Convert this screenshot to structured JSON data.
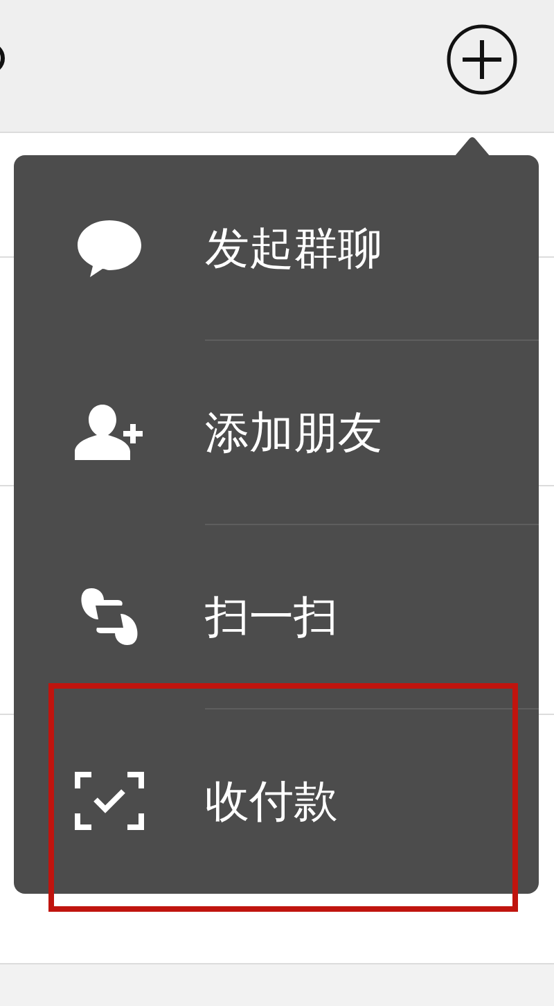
{
  "menu": {
    "items": [
      {
        "kind": "group-chat",
        "label": "发起群聊"
      },
      {
        "kind": "add-friend",
        "label": "添加朋友"
      },
      {
        "kind": "scan",
        "label": "扫一扫"
      },
      {
        "kind": "payment",
        "label": "收付款",
        "highlighted": true
      }
    ]
  }
}
